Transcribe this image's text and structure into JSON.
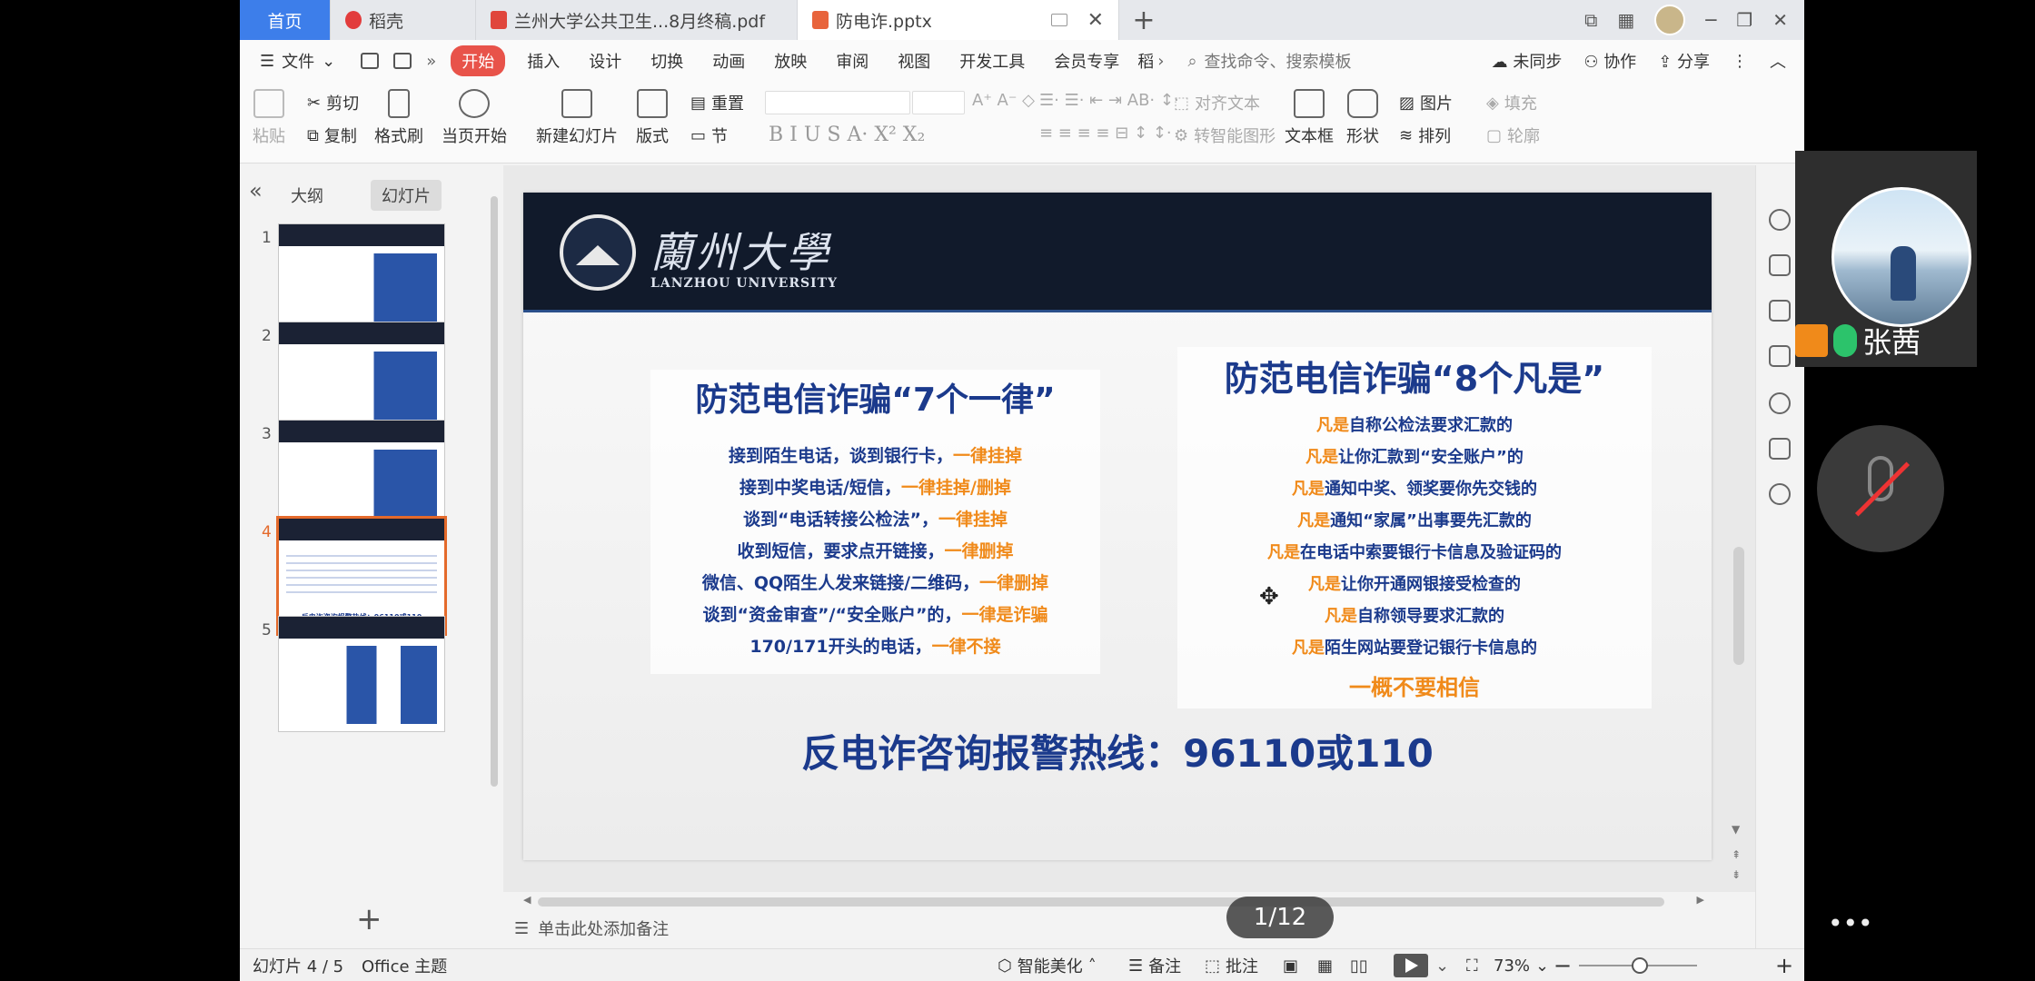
{
  "tabs": [
    {
      "label": "首页",
      "kind": "home"
    },
    {
      "label": "稻壳",
      "kind": "docer"
    },
    {
      "label": "兰州大学公共卫生...8月终稿.pdf",
      "kind": "pdf"
    },
    {
      "label": "防电诈.pptx",
      "kind": "pptx"
    }
  ],
  "menu": {
    "file": "文件",
    "tabs": [
      "开始",
      "插入",
      "设计",
      "切换",
      "动画",
      "放映",
      "审阅",
      "视图",
      "开发工具",
      "会员专享",
      "稻"
    ],
    "search_placeholder": "查找命令、搜索模板",
    "sync": "未同步",
    "collab": "协作",
    "share": "分享"
  },
  "ribbon": {
    "paste": "粘贴",
    "cut": "剪切",
    "copy": "复制",
    "format_painter": "格式刷",
    "play_from_current": "当页开始",
    "new_slide": "新建幻灯片",
    "layout": "版式",
    "reset": "重置",
    "section": "节",
    "align_text": "对齐文本",
    "smart_art": "转智能图形",
    "textbox": "文本框",
    "shapes": "形状",
    "picture": "图片",
    "arrange": "排列",
    "fill": "填充",
    "outline": "轮廓"
  },
  "left_panel": {
    "tab_outline": "大纲",
    "tab_slides": "幻灯片",
    "slides": [
      {
        "num": "1"
      },
      {
        "num": "2"
      },
      {
        "num": "3"
      },
      {
        "num": "4"
      },
      {
        "num": "5"
      }
    ],
    "thumb4_text": "反电诈咨询报警热线：96110或110"
  },
  "slide": {
    "logo_cn": "蘭州大學",
    "logo_en": "LANZHOU UNIVERSITY",
    "left_title": "防范电信诈骗“7个一律”",
    "left_lines": [
      {
        "main": "接到陌生电话，谈到银行卡，",
        "hl": "一律挂掉"
      },
      {
        "main": "接到中奖电话/短信，",
        "hl": "一律挂掉/删掉"
      },
      {
        "main": "谈到“电话转接公检法”，",
        "hl": "一律挂掉"
      },
      {
        "main": "收到短信，要求点开链接，",
        "hl": "一律删掉"
      },
      {
        "main": "微信、QQ陌生人发来链接/二维码，",
        "hl": "一律删掉"
      },
      {
        "main": "谈到“资金审查”/“安全账户”的，",
        "hl": "一律是诈骗"
      },
      {
        "main": "170/171开头的电话，",
        "hl": "一律不接"
      }
    ],
    "right_title": "防范电信诈骗“8个凡是”",
    "right_lines": [
      {
        "hl": "凡是",
        "main": "自称公检法要求汇款的"
      },
      {
        "hl": "凡是",
        "main": "让你汇款到“安全账户”的"
      },
      {
        "hl": "凡是",
        "main": "通知中奖、领奖要你先交钱的"
      },
      {
        "hl": "凡是",
        "main": "通知“家属”出事要先汇款的"
      },
      {
        "hl": "凡是",
        "main": "在电话中索要银行卡信息及验证码的"
      },
      {
        "hl": "凡是",
        "main": "让你开通网银接受检查的"
      },
      {
        "hl": "凡是",
        "main": "自称领导要求汇款的"
      },
      {
        "hl": "凡是",
        "main": "陌生网站要登记银行卡信息的"
      }
    ],
    "right_footer": "一概不要相信",
    "hotline": "反电诈咨询报警热线：96110或110"
  },
  "notes_placeholder": "单击此处添加备注",
  "page_indicator": "1/12",
  "status": {
    "slide_pos": "幻灯片 4 / 5",
    "theme": "Office 主题",
    "beautify": "智能美化",
    "notes": "备注",
    "comment": "批注",
    "zoom": "73%"
  },
  "video": {
    "name": "张茜"
  },
  "colors": {
    "accent": "#e8534a",
    "home_tab": "#3d7eea",
    "slide_blue": "#1b3a8c",
    "slide_orange": "#f08a1a",
    "header_dark": "#111a2b",
    "selected_thumb": "#e46a2b"
  }
}
